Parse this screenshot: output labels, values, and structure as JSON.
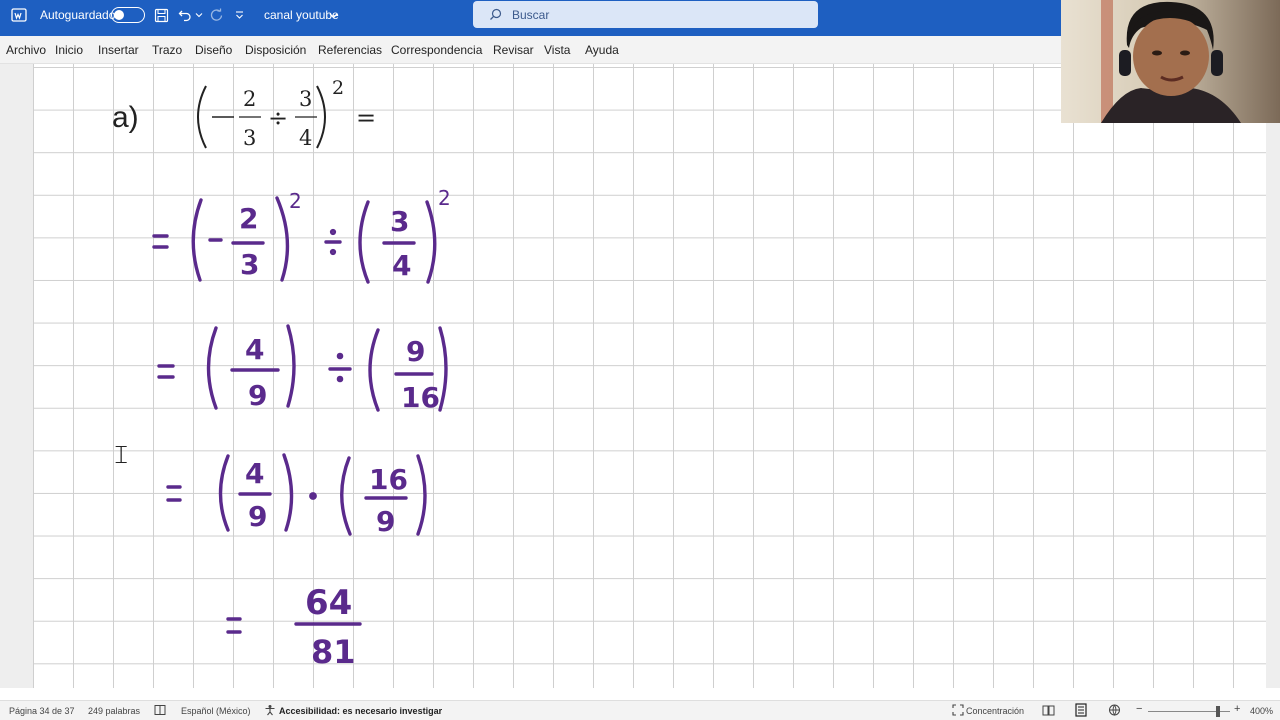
{
  "titlebar": {
    "autosave_label": "Autoguardado",
    "doc_title": "canal youtube",
    "search_placeholder": "Buscar"
  },
  "menu": [
    "Archivo",
    "Inicio",
    "Insertar",
    "Trazo",
    "Diseño",
    "Disposición",
    "Referencias",
    "Correspondencia",
    "Revisar",
    "Vista",
    "Ayuda"
  ],
  "document": {
    "problem_label": "a)",
    "typed_expression": "(−2/3 ÷ 3/4)² =",
    "handwritten_steps": [
      "= (−2/3)² ÷ (3/4)²",
      "= (4/9) ÷ (9/16)",
      "= (4/9) · (16/9)",
      "= 64/81"
    ]
  },
  "statusbar": {
    "page": "Página 34 de 37",
    "words": "249 palabras",
    "language": "Español (México)",
    "accessibility": "Accesibilidad: es necesario investigar",
    "focus": "Concentración",
    "zoom": "400%"
  },
  "colors": {
    "titlebar": "#1e5fc1",
    "ink": "#5a2a8c"
  }
}
